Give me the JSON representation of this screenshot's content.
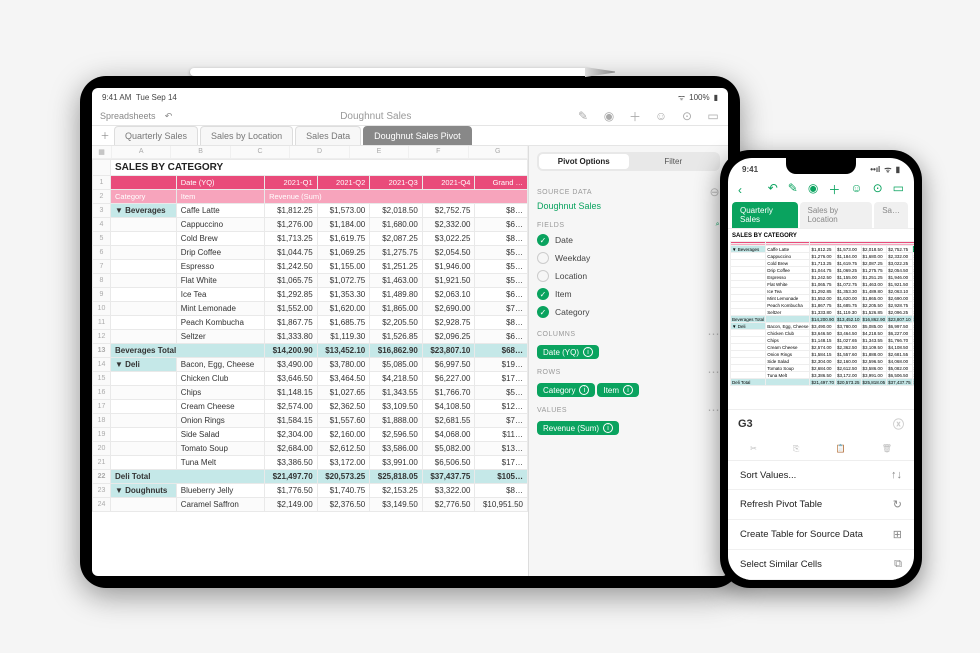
{
  "ipad": {
    "status_time": "9:41 AM",
    "status_date": "Tue Sep 14",
    "status_batt": "100%",
    "back_label": "Spreadsheets",
    "doc_title": "Doughnut Sales",
    "tabs": [
      "Quarterly Sales",
      "Sales by Location",
      "Sales Data",
      "Doughnut Sales Pivot"
    ],
    "active_tab": 3,
    "cols": [
      "",
      "A",
      "B",
      "C",
      "D",
      "E",
      "F",
      "G"
    ],
    "table": {
      "title": "SALES BY CATEGORY",
      "header": [
        "",
        "",
        "Date (YQ)",
        "2021-Q1",
        "2021-Q2",
        "2021-Q3",
        "2021-Q4",
        "Grand …"
      ],
      "sub": [
        "Category",
        "Item",
        "Revenue (Sum)",
        "",
        "",
        "",
        "",
        ""
      ],
      "rows": [
        {
          "n": 3,
          "cat": "▼ Beverages",
          "item": "Caffe Latte",
          "v": [
            "$1,812.25",
            "$1,573.00",
            "$2,018.50",
            "$2,752.75",
            "$8…"
          ]
        },
        {
          "n": 4,
          "cat": "",
          "item": "Cappuccino",
          "v": [
            "$1,276.00",
            "$1,184.00",
            "$1,680.00",
            "$2,332.00",
            "$6…"
          ]
        },
        {
          "n": 5,
          "cat": "",
          "item": "Cold Brew",
          "v": [
            "$1,713.25",
            "$1,619.75",
            "$2,087.25",
            "$3,022.25",
            "$8…"
          ]
        },
        {
          "n": 6,
          "cat": "",
          "item": "Drip Coffee",
          "v": [
            "$1,044.75",
            "$1,069.25",
            "$1,275.75",
            "$2,054.50",
            "$5…"
          ]
        },
        {
          "n": 7,
          "cat": "",
          "item": "Espresso",
          "v": [
            "$1,242.50",
            "$1,155.00",
            "$1,251.25",
            "$1,946.00",
            "$5…"
          ]
        },
        {
          "n": 8,
          "cat": "",
          "item": "Flat White",
          "v": [
            "$1,065.75",
            "$1,072.75",
            "$1,463.00",
            "$1,921.50",
            "$5…"
          ]
        },
        {
          "n": 9,
          "cat": "",
          "item": "Ice Tea",
          "v": [
            "$1,292.85",
            "$1,353.30",
            "$1,489.80",
            "$2,063.10",
            "$6…"
          ]
        },
        {
          "n": 10,
          "cat": "",
          "item": "Mint Lemonade",
          "v": [
            "$1,552.00",
            "$1,620.00",
            "$1,865.00",
            "$2,690.00",
            "$7…"
          ]
        },
        {
          "n": 11,
          "cat": "",
          "item": "Peach Kombucha",
          "v": [
            "$1,867.75",
            "$1,685.75",
            "$2,205.50",
            "$2,928.75",
            "$8…"
          ]
        },
        {
          "n": 12,
          "cat": "",
          "item": "Seltzer",
          "v": [
            "$1,333.80",
            "$1,119.30",
            "$1,526.85",
            "$2,096.25",
            "$6…"
          ]
        }
      ],
      "total1": {
        "n": 13,
        "label": "Beverages Total",
        "v": [
          "$14,200.90",
          "$13,452.10",
          "$16,862.90",
          "$23,807.10",
          "$68…"
        ]
      },
      "rows2": [
        {
          "n": 14,
          "cat": "▼ Deli",
          "item": "Bacon, Egg, Cheese",
          "v": [
            "$3,490.00",
            "$3,780.00",
            "$5,085.00",
            "$6,997.50",
            "$19…"
          ]
        },
        {
          "n": 15,
          "cat": "",
          "item": "Chicken Club",
          "v": [
            "$3,646.50",
            "$3,464.50",
            "$4,218.50",
            "$6,227.00",
            "$17…"
          ]
        },
        {
          "n": 16,
          "cat": "",
          "item": "Chips",
          "v": [
            "$1,148.15",
            "$1,027.65",
            "$1,343.55",
            "$1,766.70",
            "$5…"
          ]
        },
        {
          "n": 17,
          "cat": "",
          "item": "Cream Cheese",
          "v": [
            "$2,574.00",
            "$2,362.50",
            "$3,109.50",
            "$4,108.50",
            "$12…"
          ]
        },
        {
          "n": 18,
          "cat": "",
          "item": "Onion Rings",
          "v": [
            "$1,584.15",
            "$1,557.60",
            "$1,888.00",
            "$2,681.55",
            "$7…"
          ]
        },
        {
          "n": 19,
          "cat": "",
          "item": "Side Salad",
          "v": [
            "$2,304.00",
            "$2,160.00",
            "$2,596.50",
            "$4,068.00",
            "$11…"
          ]
        },
        {
          "n": 20,
          "cat": "",
          "item": "Tomato Soup",
          "v": [
            "$2,684.00",
            "$2,612.50",
            "$3,586.00",
            "$5,082.00",
            "$13…"
          ]
        },
        {
          "n": 21,
          "cat": "",
          "item": "Tuna Melt",
          "v": [
            "$3,386.50",
            "$3,172.00",
            "$3,991.00",
            "$6,506.50",
            "$17…"
          ]
        }
      ],
      "total2": {
        "n": 22,
        "label": "Deli Total",
        "v": [
          "$21,497.70",
          "$20,573.25",
          "$25,818.05",
          "$37,437.75",
          "$105…"
        ]
      },
      "rows3": [
        {
          "n": 23,
          "cat": "▼ Doughnuts",
          "item": "Blueberry Jelly",
          "v": [
            "$1,776.50",
            "$1,740.75",
            "$2,153.25",
            "$3,322.00",
            "$8…"
          ]
        },
        {
          "n": 24,
          "cat": "",
          "item": "Caramel Saffron",
          "v": [
            "$2,149.00",
            "$2,376.50",
            "$3,149.50",
            "$2,776.50",
            "$10,951.50"
          ]
        }
      ]
    }
  },
  "panel": {
    "seg": [
      "Pivot Options",
      "Filter"
    ],
    "source_hdr": "SOURCE DATA",
    "source_val": "Doughnut Sales",
    "fields_hdr": "FIELDS",
    "fields": [
      {
        "label": "Date",
        "on": true
      },
      {
        "label": "Weekday",
        "on": false
      },
      {
        "label": "Location",
        "on": false
      },
      {
        "label": "Item",
        "on": true
      },
      {
        "label": "Category",
        "on": true
      }
    ],
    "columns_hdr": "COLUMNS",
    "columns": [
      "Date (YQ)"
    ],
    "rows_hdr": "ROWS",
    "rows": [
      "Category",
      "Item"
    ],
    "values_hdr": "VALUES",
    "values": [
      "Revenue (Sum)"
    ]
  },
  "iphone": {
    "status_time": "9:41",
    "tabs": [
      "Quarterly Sales",
      "Sales by Location",
      "Sa…"
    ],
    "cell_ref": "G3",
    "mini_title": "SALES BY CATEGORY",
    "menu": [
      {
        "label": "Sort Values...",
        "icon": "↑↓"
      },
      {
        "label": "Refresh Pivot Table",
        "icon": "↻"
      },
      {
        "label": "Create Table for Source Data",
        "icon": "⊞"
      },
      {
        "label": "Select Similar Cells",
        "icon": "⧉"
      }
    ]
  }
}
